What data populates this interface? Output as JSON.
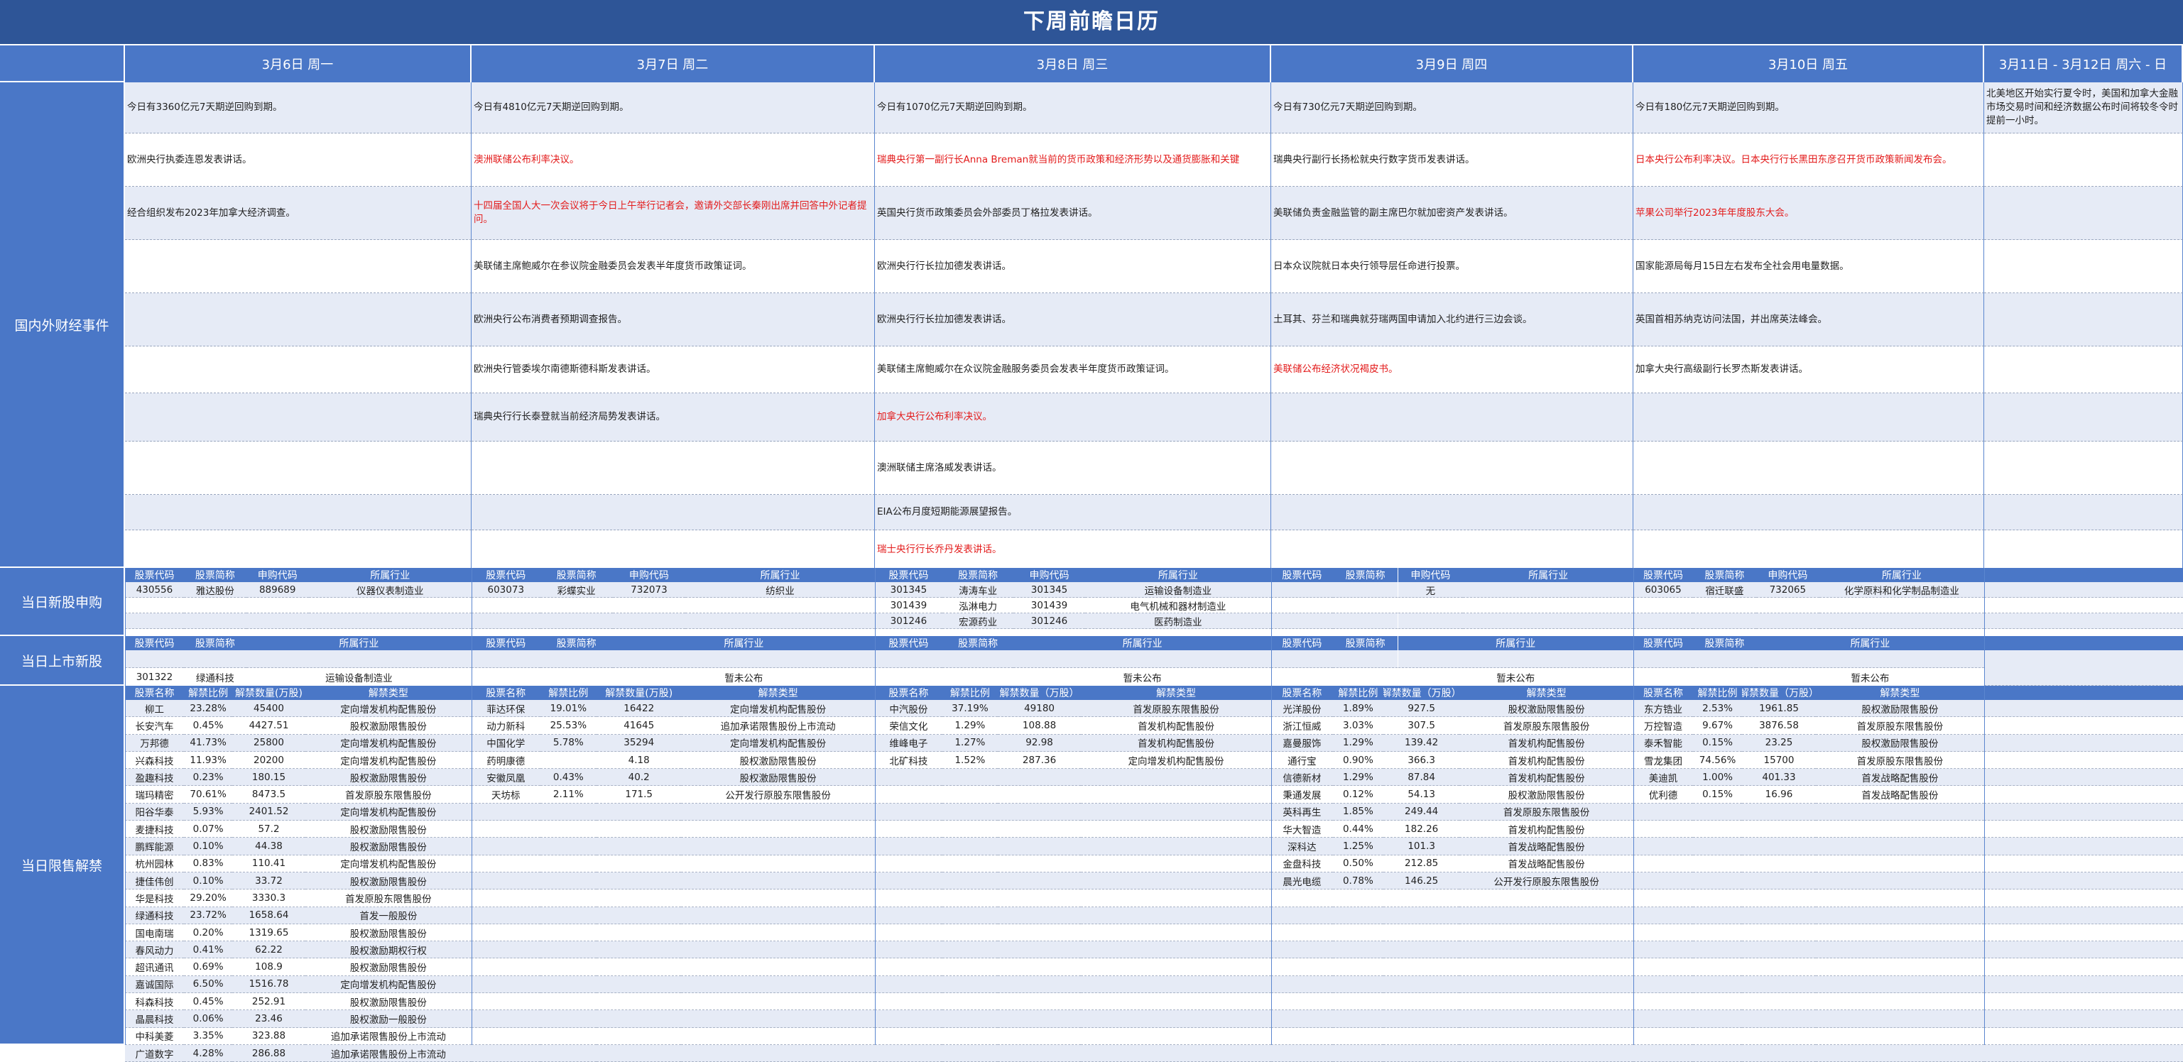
{
  "title": "下周前瞻日历",
  "days": [
    "3月6日 周一",
    "3月7日 周二",
    "3月8日 周三",
    "3月9日 周四",
    "3月10日 周五",
    "3月11日 - 3月12日 周六 - 日"
  ],
  "sections": {
    "events": "国内外财经事件",
    "new_stock_subscription": "当日新股申购",
    "new_listing": "当日上市新股",
    "lockup_expiry": "当日限售解禁"
  },
  "events": [
    [
      "今日有3360亿元7天期逆回购到期。",
      "今日有4810亿元7天期逆回购到期。",
      "今日有1070亿元7天期逆回购到期。",
      "今日有730亿元7天期逆回购到期。",
      "今日有180亿元7天期逆回购到期。",
      "北美地区开始实行夏令时，美国和加拿大金融市场交易时间和经济数据公布时间将较冬令时提前一小时。"
    ],
    [
      "欧洲央行执委连恩发表讲话。",
      "澳洲联储公布利率决议。",
      "瑞典央行第一副行长Anna Breman就当前的货币政策和经济形势以及通货膨胀和关键",
      "瑞典央行副行长扬松就央行数字货币发表讲话。",
      "日本央行公布利率决议。日本央行行长黑田东彦召开货币政策新闻发布会。",
      ""
    ],
    [
      "经合组织发布2023年加拿大经济调查。",
      "十四届全国人大一次会议将于今日上午举行记者会，邀请外交部长秦刚出席并回答中外记者提问。",
      "英国央行货币政策委员会外部委员丁格拉发表讲话。",
      "美联储负责金融监管的副主席巴尔就加密资产发表讲话。",
      "苹果公司举行2023年年度股东大会。",
      ""
    ],
    [
      "",
      "美联储主席鲍威尔在参议院金融委员会发表半年度货币政策证词。",
      "欧洲央行行长拉加德发表讲话。",
      "日本众议院就日本央行领导层任命进行投票。",
      "国家能源局每月15日左右发布全社会用电量数据。",
      ""
    ],
    [
      "",
      "欧洲央行公布消费者预期调查报告。",
      "欧洲央行行长拉加德发表讲话。",
      "土耳其、芬兰和瑞典就芬瑞两国申请加入北约进行三边会谈。",
      "英国首相苏纳克访问法国，并出席英法峰会。",
      ""
    ],
    [
      "",
      "欧洲央行管委埃尔南德斯德科斯发表讲话。",
      "美联储主席鲍威尔在众议院金融服务委员会发表半年度货币政策证词。",
      "美联储公布经济状况褐皮书。",
      "加拿大央行高级副行长罗杰斯发表讲话。",
      ""
    ],
    [
      "",
      "瑞典央行行长泰登就当前经济局势发表讲话。",
      "加拿大央行公布利率决议。",
      "",
      "",
      ""
    ],
    [
      "",
      "",
      "澳洲联储主席洛威发表讲话。",
      "",
      "",
      ""
    ],
    [
      "",
      "",
      "EIA公布月度短期能源展望报告。",
      "",
      "",
      ""
    ],
    [
      "",
      "",
      "瑞士央行行长乔丹发表讲话。",
      "",
      "",
      ""
    ]
  ],
  "event_red_cells": [
    "1-1",
    "1-2",
    "1-4",
    "2-1",
    "2-4",
    "5-3",
    "6-2",
    "9-2"
  ],
  "ipo_headers": [
    "股票代码",
    "股票简称",
    "申购代码",
    "所属行业"
  ],
  "ipo": [
    [
      [
        "430556",
        "雅达股份",
        "889689",
        "仪器仪表制造业"
      ],
      [
        "",
        "",
        "",
        ""
      ],
      [
        "",
        "",
        "",
        ""
      ]
    ],
    [
      [
        "603073",
        "彩蝶实业",
        "732073",
        "纺织业"
      ],
      [
        "",
        "",
        "",
        ""
      ],
      [
        "",
        "",
        "",
        ""
      ]
    ],
    [
      [
        "301345",
        "涛涛车业",
        "301345",
        "运输设备制造业"
      ],
      [
        "301439",
        "泓淋电力",
        "301439",
        "电气机械和器材制造业"
      ],
      [
        "301246",
        "宏源药业",
        "301246",
        "医药制造业"
      ]
    ],
    [
      [
        "",
        "",
        "无",
        ""
      ],
      [
        "",
        "",
        "",
        ""
      ],
      [
        "",
        "",
        "",
        ""
      ]
    ],
    [
      [
        "603065",
        "宿迁联盛",
        "732065",
        "化学原料和化学制品制造业"
      ],
      [
        "",
        "",
        "",
        ""
      ],
      [
        "",
        "",
        "",
        ""
      ]
    ]
  ],
  "listing_headers": [
    "股票代码",
    "股票简称",
    "所属行业"
  ],
  "listing": [
    [
      [
        "",
        "",
        ""
      ],
      [
        "301322",
        "绿通科技",
        "运输设备制造业"
      ]
    ],
    [
      [
        "",
        "",
        ""
      ],
      [
        "",
        "",
        "暂未公布"
      ]
    ],
    [
      [
        "",
        "",
        ""
      ],
      [
        "",
        "",
        "暂未公布"
      ]
    ],
    [
      [
        "",
        "",
        ""
      ],
      [
        "",
        "",
        "暂未公布"
      ]
    ],
    [
      [
        "",
        "",
        ""
      ],
      [
        "",
        "",
        "暂未公布"
      ]
    ]
  ],
  "lockup_headers": [
    [
      "股票名称",
      "解禁比例",
      "解禁数量(万股)",
      "解禁类型"
    ],
    [
      "股票名称",
      "解禁比例",
      "解禁数量(万股)",
      "解禁类型"
    ],
    [
      "股票名称",
      "解禁比例",
      "解禁数量（万股）",
      "解禁类型"
    ],
    [
      "股票名称",
      "解禁比例",
      "解禁数量（万股）",
      "解禁类型"
    ],
    [
      "股票名称",
      "解禁比例",
      "解禁数量（万股）",
      "解禁类型"
    ]
  ],
  "lockup": [
    [
      [
        "柳工",
        "23.28%",
        "45400",
        "定向增发机构配售股份"
      ],
      [
        "长安汽车",
        "0.45%",
        "4427.51",
        "股权激励限售股份"
      ],
      [
        "万邦德",
        "41.73%",
        "25800",
        "定向增发机构配售股份"
      ],
      [
        "兴森科技",
        "11.93%",
        "20200",
        "定向增发机构配售股份"
      ],
      [
        "盈趣科技",
        "0.23%",
        "180.15",
        "股权激励限售股份"
      ],
      [
        "瑞玛精密",
        "70.61%",
        "8473.5",
        "首发原股东限售股份"
      ],
      [
        "阳谷华泰",
        "5.93%",
        "2401.52",
        "定向增发机构配售股份"
      ],
      [
        "麦捷科技",
        "0.07%",
        "57.2",
        "股权激励限售股份"
      ],
      [
        "鹏辉能源",
        "0.10%",
        "44.38",
        "股权激励限售股份"
      ],
      [
        "杭州园林",
        "0.83%",
        "110.41",
        "定向增发机构配售股份"
      ],
      [
        "捷佳伟创",
        "0.10%",
        "33.72",
        "股权激励限售股份"
      ],
      [
        "华是科技",
        "29.20%",
        "3330.3",
        "首发原股东限售股份"
      ],
      [
        "绿通科技",
        "23.72%",
        "1658.64",
        "首发一般股份"
      ],
      [
        "国电南瑞",
        "0.20%",
        "1319.65",
        "股权激励限售股份"
      ],
      [
        "春风动力",
        "0.41%",
        "62.22",
        "股权激励期权行权"
      ],
      [
        "超讯通讯",
        "0.69%",
        "108.9",
        "股权激励限售股份"
      ],
      [
        "嘉诚国际",
        "6.50%",
        "1516.78",
        "定向增发机构配售股份"
      ],
      [
        "科森科技",
        "0.45%",
        "252.91",
        "股权激励限售股份"
      ],
      [
        "晶晨科技",
        "0.06%",
        "23.46",
        "股权激励一般股份"
      ],
      [
        "中科美菱",
        "3.35%",
        "323.88",
        "追加承诺限售股份上市流动"
      ],
      [
        "广道数字",
        "4.28%",
        "286.88",
        "追加承诺限售股份上市流动"
      ]
    ],
    [
      [
        "菲达环保",
        "19.01%",
        "16422",
        "定向增发机构配售股份"
      ],
      [
        "动力新科",
        "25.53%",
        "41645",
        "追加承诺限售股份上市流动"
      ],
      [
        "中国化学",
        "5.78%",
        "35294",
        "定向增发机构配售股份"
      ],
      [
        "药明康德",
        "",
        "4.18",
        "股权激励限售股份"
      ],
      [
        "安徽凤凰",
        "0.43%",
        "40.2",
        "股权激励限售股份"
      ],
      [
        "天坊标",
        "2.11%",
        "171.5",
        "公开发行原股东限售股份"
      ]
    ],
    [
      [
        "中汽股份",
        "37.19%",
        "49180",
        "首发原股东限售股份"
      ],
      [
        "荣信文化",
        "1.29%",
        "108.88",
        "首发机构配售股份"
      ],
      [
        "维峰电子",
        "1.27%",
        "92.98",
        "首发机构配售股份"
      ],
      [
        "北矿科技",
        "1.52%",
        "287.36",
        "定向增发机构配售股份"
      ]
    ],
    [
      [
        "光洋股份",
        "1.89%",
        "927.5",
        "股权激励限售股份"
      ],
      [
        "浙江恒威",
        "3.03%",
        "307.5",
        "首发原股东限售股份"
      ],
      [
        "嘉曼服饰",
        "1.29%",
        "139.42",
        "首发机构配售股份"
      ],
      [
        "通行宝",
        "0.90%",
        "366.3",
        "首发机构配售股份"
      ],
      [
        "信德新材",
        "1.29%",
        "87.84",
        "首发机构配售股份"
      ],
      [
        "秉通发展",
        "0.12%",
        "54.13",
        "股权激励限售股份"
      ],
      [
        "英科再生",
        "1.85%",
        "249.44",
        "首发原股东限售股份"
      ],
      [
        "华大智造",
        "0.44%",
        "182.26",
        "首发机构配售股份"
      ],
      [
        "深科达",
        "1.25%",
        "101.3",
        "首发战略配售股份"
      ],
      [
        "金盘科技",
        "0.50%",
        "212.85",
        "首发战略配售股份"
      ],
      [
        "晨光电缆",
        "0.78%",
        "146.25",
        "公开发行原股东限售股份"
      ]
    ],
    [
      [
        "东方锆业",
        "2.53%",
        "1961.85",
        "股权激励限售股份"
      ],
      [
        "万控智造",
        "9.67%",
        "3876.58",
        "首发原股东限售股份"
      ],
      [
        "泰禾智能",
        "0.15%",
        "23.25",
        "股权激励限售股份"
      ],
      [
        "雪龙集团",
        "74.56%",
        "15700",
        "首发原股东限售股份"
      ],
      [
        "美迪凯",
        "1.00%",
        "401.33",
        "首发战略配售股份"
      ],
      [
        "优利德",
        "0.15%",
        "16.96",
        "首发战略配售股份"
      ]
    ]
  ]
}
